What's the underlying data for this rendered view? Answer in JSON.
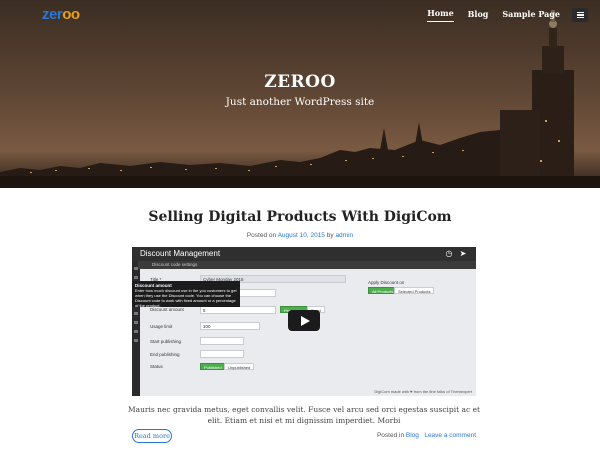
{
  "site": {
    "logo_part1": "zer",
    "logo_part2": "oo",
    "title": "ZEROO",
    "tagline": "Just another WordPress site"
  },
  "nav": {
    "items": [
      {
        "label": "Home",
        "active": true
      },
      {
        "label": "Blog",
        "active": false
      },
      {
        "label": "Sample Page",
        "active": false
      }
    ],
    "menu_icon": "hamburger-icon"
  },
  "post": {
    "title": "Selling Digital Products With DigiCom",
    "meta_prefix": "Posted on",
    "date": "August 10, 2015",
    "by": "by",
    "author": "admin",
    "excerpt": "Mauris nec gravida metus, eget convallis velit. Fusce vel arcu sed orci egestas suscipit ac et elit. Etiam et nisi et mi dignissim imperdiet. Morbi",
    "read_more": "Read more",
    "posted_in_prefix": "Posted in",
    "category": "Blog",
    "comment_link": "Leave a comment"
  },
  "video": {
    "title": "Discount Management",
    "subheader": "Discount code settings",
    "title_label": "Title *",
    "title_value": "Cyber Monday 2015",
    "tooltip_heading": "Discount amount",
    "tooltip_text": "Enter how much discount use in the you customers to get when they use the Discount code. You can choose the Discount code to work with fixed amount or a percentage of the product.",
    "discount_label": "Discount amount",
    "discount_value": "5",
    "btn_percentage": "Percentage",
    "btn_fixed": "Fixed",
    "usage_label": "Usage limit",
    "usage_value": "100",
    "start_label": "Start publishing",
    "end_label": "End publishing",
    "status_label": "Status",
    "btn_published": "Published",
    "btn_unpublished": "Unpublished",
    "apply_label": "Apply Discount on",
    "btn_all_products": "All Products",
    "btn_selected_products": "Selected Products",
    "footer": "DigiCom made with ♥ from the fine folks of Themexpert",
    "clock_icon": "clock-icon",
    "share_icon": "share-icon",
    "play_icon": "play-icon"
  },
  "colors": {
    "accent": "#2a77d6",
    "logo_orange": "#e8a11b",
    "green": "#4cae4c"
  }
}
